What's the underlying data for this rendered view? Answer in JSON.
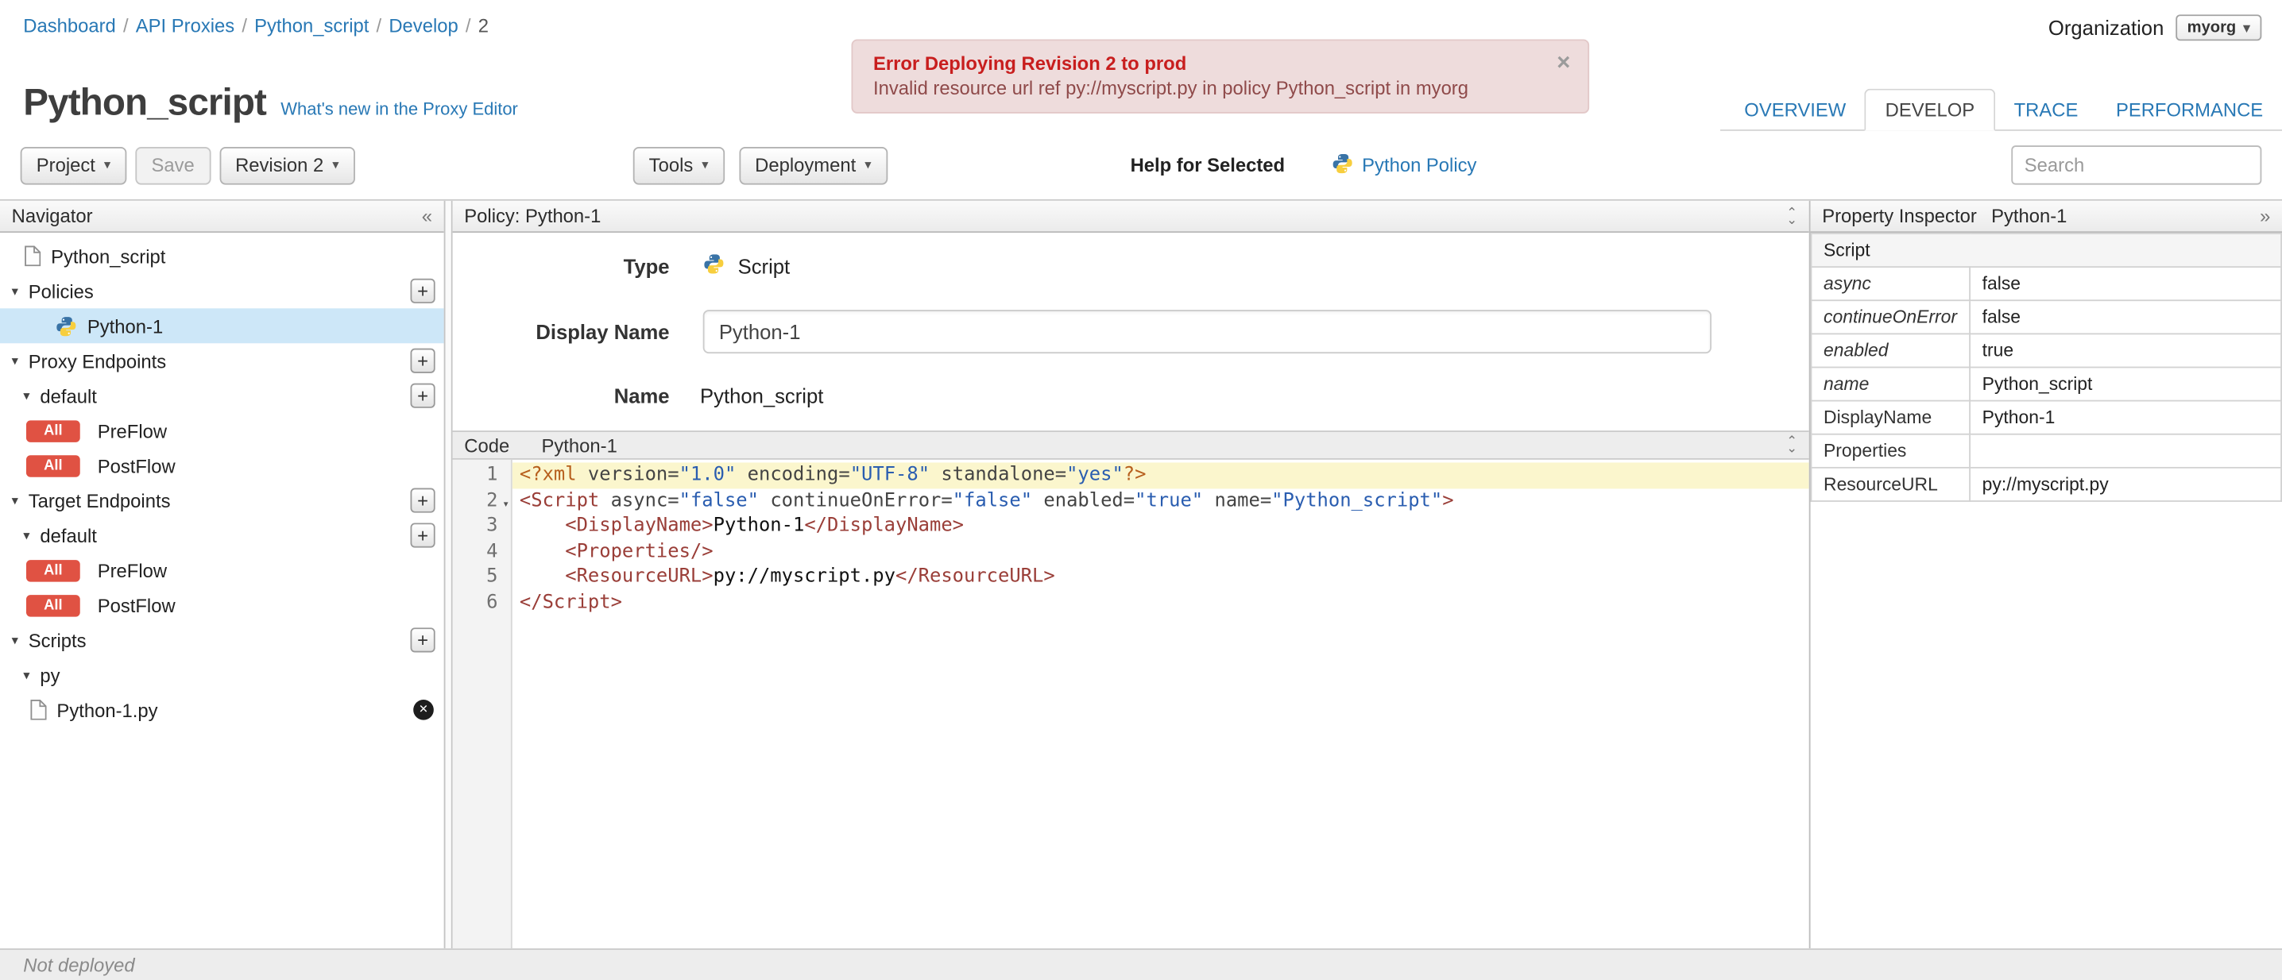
{
  "icons": {
    "caret_down": "▾",
    "collapse_left": "«",
    "expand_right": "»",
    "close": "×",
    "chevron_up": "⌃",
    "chevron_down": "⌄",
    "plus": "+",
    "delete_x": "✕"
  },
  "breadcrumb": {
    "separator": "/",
    "links": [
      "Dashboard",
      "API Proxies",
      "Python_script",
      "Develop"
    ],
    "current": "2"
  },
  "organization": {
    "label": "Organization",
    "value": "myorg"
  },
  "error_banner": {
    "title": "Error Deploying Revision 2 to prod",
    "message": "Invalid resource url ref py://myscript.py in policy Python_script in myorg"
  },
  "page": {
    "title": "Python_script",
    "whats_new_link": "What's new in the Proxy Editor"
  },
  "tabs": {
    "items": [
      {
        "label": "OVERVIEW",
        "active": false
      },
      {
        "label": "DEVELOP",
        "active": true
      },
      {
        "label": "TRACE",
        "active": false
      },
      {
        "label": "PERFORMANCE",
        "active": false
      }
    ]
  },
  "toolbar": {
    "project_button": "Project",
    "save_button": "Save",
    "revision_button": "Revision 2",
    "tools_button": "Tools",
    "deployment_button": "Deployment",
    "help_for_selected_label": "Help for Selected",
    "policy_help_link": "Python Policy",
    "search_placeholder": "Search"
  },
  "navigator": {
    "header": "Navigator",
    "rows": [
      {
        "icon": "doc",
        "label": "Python_script",
        "pad": 16
      },
      {
        "caret": true,
        "label": "Policies",
        "plus": true,
        "pad": 8
      },
      {
        "icon": "python",
        "label": "Python-1",
        "selected": true,
        "pad": 38
      },
      {
        "caret": true,
        "label": "Proxy Endpoints",
        "plus": true,
        "pad": 8
      },
      {
        "caret": true,
        "label": "default",
        "plus": true,
        "pad": 16
      },
      {
        "badge": "All",
        "label": "PreFlow",
        "pad": 18
      },
      {
        "badge": "All",
        "label": "PostFlow",
        "pad": 18
      },
      {
        "caret": true,
        "label": "Target Endpoints",
        "plus": true,
        "pad": 8
      },
      {
        "caret": true,
        "label": "default",
        "plus": true,
        "pad": 16
      },
      {
        "badge": "All",
        "label": "PreFlow",
        "pad": 18
      },
      {
        "badge": "All",
        "label": "PostFlow",
        "pad": 18
      },
      {
        "caret": true,
        "label": "Scripts",
        "plus": true,
        "pad": 8
      },
      {
        "caret": true,
        "label": "py",
        "pad": 16
      },
      {
        "icon": "doc",
        "label": "Python-1.py",
        "del": true,
        "pad": 20
      }
    ]
  },
  "policy_panel": {
    "header": "Policy: Python-1",
    "form": {
      "type_label": "Type",
      "type_value": "Script",
      "display_name_label": "Display Name",
      "display_name_value": "Python-1",
      "name_label": "Name",
      "name_value": "Python_script"
    },
    "code": {
      "header_label": "Code",
      "header_file": "Python-1",
      "lines": [
        {
          "num": "1",
          "highlight": true,
          "tokens": [
            [
              "pi",
              "<?xml "
            ],
            [
              "attr",
              "version="
            ],
            [
              "str",
              "\"1.0\""
            ],
            [
              "plain",
              " "
            ],
            [
              "attr",
              "encoding="
            ],
            [
              "str",
              "\"UTF-8\""
            ],
            [
              "plain",
              " "
            ],
            [
              "attr",
              "standalone="
            ],
            [
              "str",
              "\"yes\""
            ],
            [
              "pi",
              "?>"
            ]
          ]
        },
        {
          "num": "2",
          "fold": true,
          "tokens": [
            [
              "tag",
              "<Script "
            ],
            [
              "attr",
              "async="
            ],
            [
              "str",
              "\"false\""
            ],
            [
              "plain",
              " "
            ],
            [
              "attr",
              "continueOnError="
            ],
            [
              "str",
              "\"false\""
            ],
            [
              "plain",
              " "
            ],
            [
              "attr",
              "enabled="
            ],
            [
              "str",
              "\"true\""
            ],
            [
              "plain",
              " "
            ],
            [
              "attr",
              "name="
            ],
            [
              "str",
              "\"Python_script\""
            ],
            [
              "tag",
              ">"
            ]
          ]
        },
        {
          "num": "3",
          "tokens": [
            [
              "plain",
              "    "
            ],
            [
              "tag",
              "<DisplayName>"
            ],
            [
              "plain",
              "Python-1"
            ],
            [
              "tag",
              "</DisplayName>"
            ]
          ]
        },
        {
          "num": "4",
          "tokens": [
            [
              "plain",
              "    "
            ],
            [
              "tag",
              "<Properties/>"
            ]
          ]
        },
        {
          "num": "5",
          "tokens": [
            [
              "plain",
              "    "
            ],
            [
              "tag",
              "<ResourceURL>"
            ],
            [
              "plain",
              "py://myscript.py"
            ],
            [
              "tag",
              "</ResourceURL>"
            ]
          ]
        },
        {
          "num": "6",
          "tokens": [
            [
              "tag",
              "</Script>"
            ]
          ]
        }
      ]
    }
  },
  "inspector": {
    "header": "Property Inspector",
    "header_context": "Python-1",
    "section": "Script",
    "rows": [
      {
        "key": "async",
        "value": "false",
        "attr": true
      },
      {
        "key": "continueOnError",
        "value": "false",
        "attr": true
      },
      {
        "key": "enabled",
        "value": "true",
        "attr": true
      },
      {
        "key": "name",
        "value": "Python_script",
        "attr": true
      },
      {
        "key": "DisplayName",
        "value": "Python-1",
        "attr": false
      },
      {
        "key": "Properties",
        "value": "",
        "attr": false
      },
      {
        "key": "ResourceURL",
        "value": "py://myscript.py",
        "attr": false
      }
    ]
  },
  "statusbar": {
    "text": "Not deployed"
  }
}
